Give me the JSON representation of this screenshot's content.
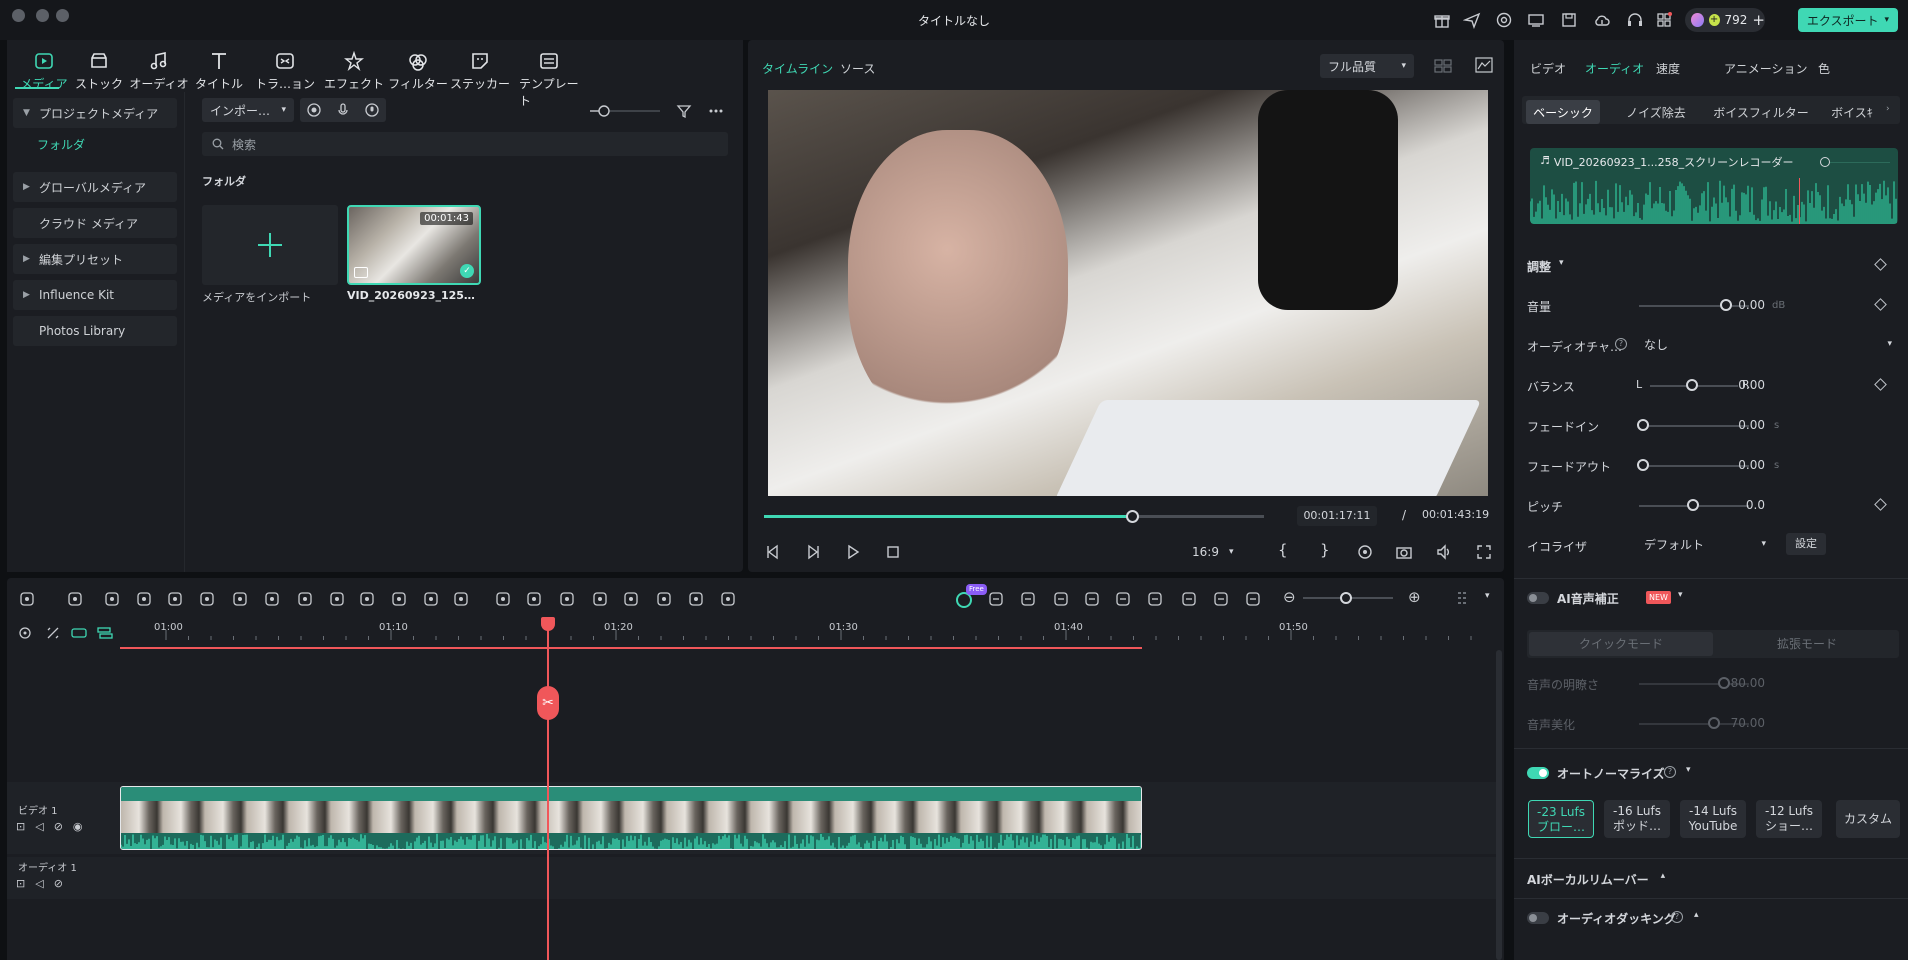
{
  "window": {
    "title": "タイトルなし"
  },
  "header": {
    "credits": "792",
    "export_label": "エクスポート"
  },
  "media_tabs": [
    {
      "label": "メディア",
      "icon": "media-icon"
    },
    {
      "label": "ストック",
      "icon": "stock-icon"
    },
    {
      "label": "オーディオ",
      "icon": "audio-icon"
    },
    {
      "label": "タイトル",
      "icon": "title-icon"
    },
    {
      "label": "トラ…ョン",
      "icon": "transition-icon"
    },
    {
      "label": "エフェクト",
      "icon": "effect-icon"
    },
    {
      "label": "フィルター",
      "icon": "filter-icon"
    },
    {
      "label": "ステッカー",
      "icon": "sticker-icon"
    },
    {
      "label": "テンプレート",
      "icon": "template-icon"
    }
  ],
  "sidebar": {
    "project_media": "プロジェクトメディア",
    "folder": "フォルダ",
    "global_media": "グローバルメディア",
    "cloud_media": "クラウド メディア",
    "edit_presets": "編集プリセット",
    "influence_kit": "Influence Kit",
    "photos_library": "Photos Library"
  },
  "media": {
    "import_dropdown": "インポー…",
    "search_placeholder": "検索",
    "folder_heading": "フォルダ",
    "import_tile_label": "メディアをインポート",
    "clip_name": "VID_20260923_125…",
    "clip_duration": "00:01:43"
  },
  "player": {
    "tab_timeline": "タイムライン",
    "tab_source": "ソース",
    "quality": "フル品質",
    "current_time": "00:01:17:11",
    "separator": "/",
    "total_time": "00:01:43:19",
    "aspect": "16:9",
    "progress": 0.735
  },
  "props": {
    "tabs": [
      "ビデオ",
      "オーディオ",
      "速度",
      "アニメーション",
      "色"
    ],
    "subtabs": [
      "ベーシック",
      "ノイズ除去",
      "ボイスフィルター",
      "ボイスｷ"
    ],
    "clip_title": "VID_20260923_1...258_スクリーンレコーダー",
    "adjust": "調整",
    "volume_label": "音量",
    "volume_value": "0.00",
    "volume_unit": "dB",
    "channel_label": "オーディオチャ…",
    "channel_value": "なし",
    "balance_label": "バランス",
    "balance_l": "L",
    "balance_r": "R",
    "balance_value": "0.00",
    "fadein_label": "フェードイン",
    "fadein_value": "0.00",
    "fadein_unit": "s",
    "fadeout_label": "フェードアウト",
    "fadeout_value": "0.00",
    "fadeout_unit": "s",
    "pitch_label": "ピッチ",
    "pitch_value": "0.0",
    "eq_label": "イコライザ",
    "eq_value": "デフォルト",
    "eq_settings": "設定",
    "ai_correction": "AI音声補正",
    "new_badge": "NEW",
    "quick_mode": "クイックモード",
    "ext_mode": "拡張モード",
    "clarity_label": "音声の明瞭さ",
    "clarity_value": "80.00",
    "beautify_label": "音声美化",
    "beautify_value": "70.00",
    "auto_normalize": "オートノーマライズ",
    "lufs": [
      {
        "top": "-23 Lufs",
        "bottom": "ブロー…"
      },
      {
        "top": "-16 Lufs",
        "bottom": "ポッド…"
      },
      {
        "top": "-14 Lufs",
        "bottom": "YouTube"
      },
      {
        "top": "-12 Lufs",
        "bottom": "ショー…"
      }
    ],
    "custom": "カスタム",
    "vocal_remover": "AIボーカルリムーバー",
    "ducking": "オーディオダッキング"
  },
  "timeline": {
    "ruler": [
      "01:00",
      "01:10",
      "01:20",
      "01:30",
      "01:40",
      "01:50"
    ],
    "video_track": "ビデオ 1",
    "audio_track": "オーディオ 1",
    "ai_badge": "Free"
  },
  "colors": {
    "accent": "#3fd8b4",
    "playhead": "#f0575a",
    "panel": "#1b1d22"
  }
}
